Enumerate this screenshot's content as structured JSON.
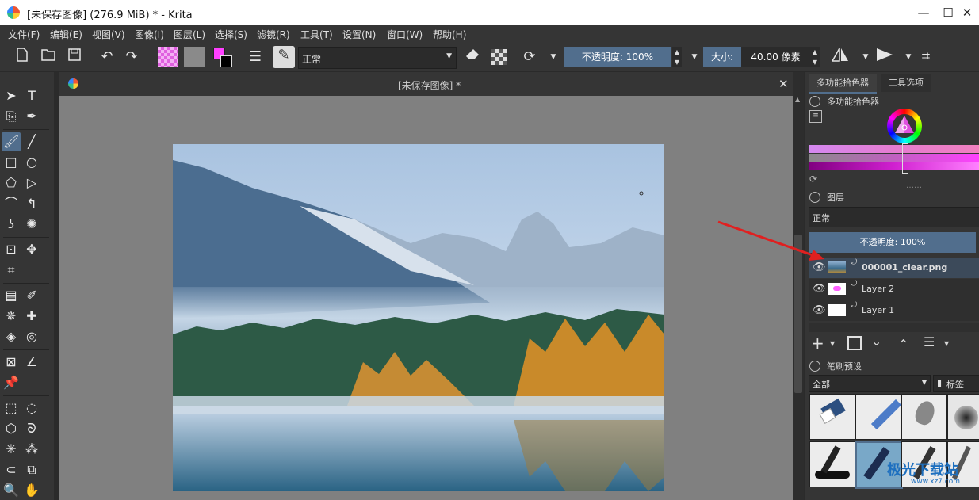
{
  "window": {
    "title": "[未保存图像]  (276.9 MiB)  * - Krita",
    "minimize": "—",
    "maximize": "☐",
    "close": "✕"
  },
  "menu": [
    "文件(F)",
    "编辑(E)",
    "视图(V)",
    "图像(I)",
    "图层(L)",
    "选择(S)",
    "滤镜(R)",
    "工具(T)",
    "设置(N)",
    "窗口(W)",
    "帮助(H)"
  ],
  "toolbar": {
    "blend_mode": "正常",
    "opacity_label": "不透明度:  100%",
    "size_label": "大小:",
    "size_value": "40.00 像素"
  },
  "canvas": {
    "tab_title": "[未保存图像]  *",
    "close": "✕"
  },
  "dock": {
    "tabs": [
      "多功能拾色器",
      "工具选项"
    ],
    "color_selector_title": "多功能拾色器",
    "layers_title": "图层",
    "layer_blend": "正常",
    "layer_opacity": "不透明度:  100%",
    "layers": [
      {
        "name": "000001_clear.png",
        "selected": true
      },
      {
        "name": "Layer 2",
        "selected": false
      },
      {
        "name": "Layer 1",
        "selected": false
      }
    ],
    "brush_title": "笔刷预设",
    "brush_filter": "全部",
    "brush_tag": "标签"
  },
  "watermark": {
    "text": "极光下载站",
    "url": "www.xz7.com"
  },
  "colors": {
    "accent": "#516e8d",
    "panel": "#353535",
    "canvas_bg": "#808080",
    "fg": "#ff40ff",
    "arrow": "#e02020"
  }
}
